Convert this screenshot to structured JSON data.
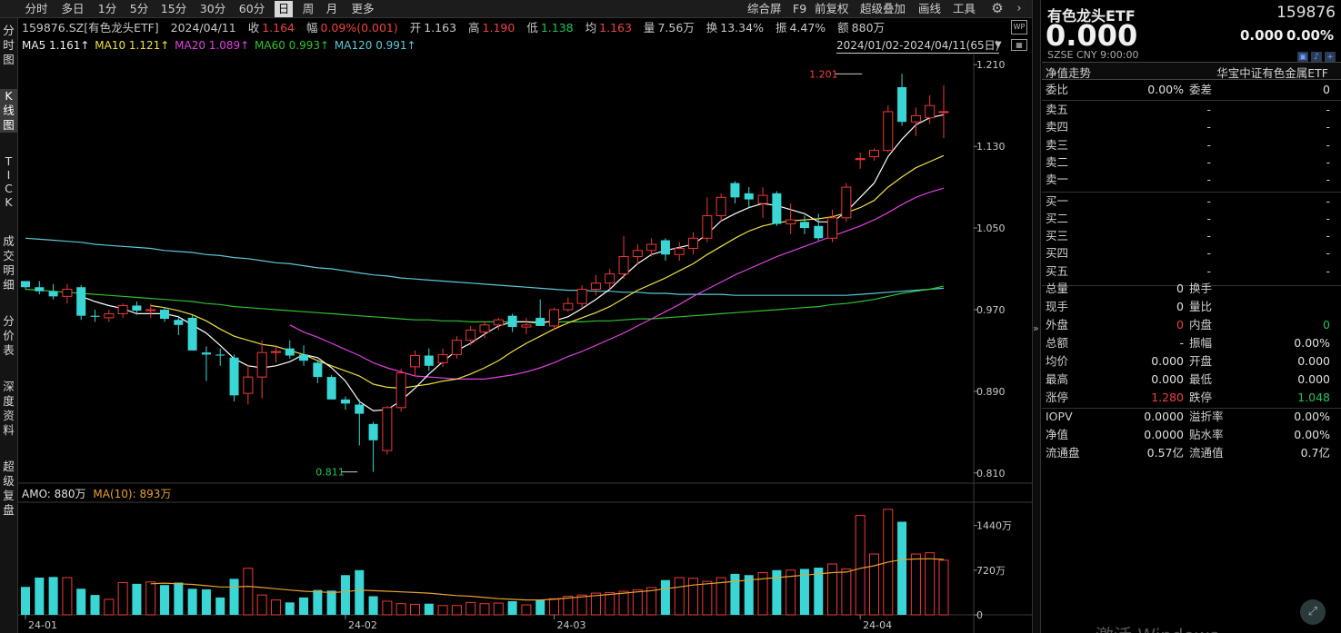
{
  "toolbar": {
    "periods": [
      "分时",
      "多日",
      "1分",
      "5分",
      "15分",
      "30分",
      "60分",
      "日",
      "周",
      "月",
      "更多"
    ],
    "active_period": "日",
    "tools": [
      "综合屏",
      "F9",
      "前复权",
      "超级叠加",
      "画线",
      "工具"
    ]
  },
  "left_tabs": [
    {
      "label": "分时图",
      "active": false
    },
    {
      "label": "K线图",
      "active": true
    },
    {
      "label": "TICK",
      "active": false
    },
    {
      "label": "成交明细",
      "active": false
    },
    {
      "label": "分价表",
      "active": false
    },
    {
      "label": "深度资料",
      "active": false
    },
    {
      "label": "超级复盘",
      "active": false
    }
  ],
  "info": {
    "symbol": "159876.SZ[有色龙头ETF]",
    "date": "2024/04/11",
    "close_label": "收",
    "close": "1.164",
    "change_label": "幅",
    "change": "0.09%(0.001)",
    "open_label": "开",
    "open": "1.163",
    "high_label": "高",
    "high": "1.190",
    "low_label": "低",
    "low": "1.138",
    "avg_label": "均",
    "avg": "1.163",
    "vol_label": "量",
    "vol": "7.56万",
    "turnover_label": "换",
    "turnover": "13.34%",
    "amplitude_label": "振",
    "amplitude": "4.47%",
    "amount_label": "额",
    "amount": "880万"
  },
  "ma_line": {
    "ma5": "MA5 1.161↑",
    "ma10": "MA10 1.121↑",
    "ma20": "MA20 1.089↑",
    "ma60": "MA60 0.993↑",
    "ma120": "MA120 0.991↑"
  },
  "date_range": "2024/01/02-2024/04/11(65日)",
  "colors": {
    "up": "#f03838",
    "down": "#3ad6d6",
    "ma5": "#ffffff",
    "ma10": "#f0e040",
    "ma20": "#e040e0",
    "ma60": "#30c030",
    "ma120": "#5cc8d8",
    "vol_ma": "#e8a030"
  },
  "amo_line": {
    "amo": "AMO: 880万",
    "ma10": "MA(10): 893万"
  },
  "chart_data": {
    "type": "candlestick",
    "y_ticks": [
      "1.210",
      "1.130",
      "1.050",
      "0.970",
      "0.890",
      "0.810"
    ],
    "ylim": [
      0.8,
      1.22
    ],
    "x_ticks": [
      {
        "label": "24-01",
        "index": 0
      },
      {
        "label": "24-02",
        "index": 23
      },
      {
        "label": "24-03",
        "index": 38
      },
      {
        "label": "24-04",
        "index": 60
      }
    ],
    "high_annotation": {
      "label": "1.201",
      "index": 60,
      "value": 1.201
    },
    "low_annotation": {
      "label": "0.811",
      "index": 24,
      "value": 0.811
    },
    "ohlc": [
      [
        0.998,
        0.998,
        0.99,
        0.992
      ],
      [
        0.992,
        0.998,
        0.985,
        0.988
      ],
      [
        0.988,
        0.995,
        0.98,
        0.983
      ],
      [
        0.983,
        0.995,
        0.976,
        0.99
      ],
      [
        0.992,
        0.994,
        0.96,
        0.964
      ],
      [
        0.964,
        0.97,
        0.958,
        0.963
      ],
      [
        0.962,
        0.97,
        0.958,
        0.966
      ],
      [
        0.966,
        0.976,
        0.962,
        0.974
      ],
      [
        0.974,
        0.978,
        0.965,
        0.969
      ],
      [
        0.969,
        0.976,
        0.962,
        0.97
      ],
      [
        0.97,
        0.972,
        0.958,
        0.961
      ],
      [
        0.96,
        0.964,
        0.945,
        0.955
      ],
      [
        0.962,
        0.965,
        0.93,
        0.93
      ],
      [
        0.928,
        0.934,
        0.9,
        0.926
      ],
      [
        0.926,
        0.932,
        0.915,
        0.925
      ],
      [
        0.923,
        0.926,
        0.88,
        0.886
      ],
      [
        0.888,
        0.916,
        0.877,
        0.904
      ],
      [
        0.904,
        0.94,
        0.883,
        0.928
      ],
      [
        0.928,
        0.935,
        0.918,
        0.929
      ],
      [
        0.932,
        0.94,
        0.922,
        0.925
      ],
      [
        0.926,
        0.935,
        0.915,
        0.92
      ],
      [
        0.918,
        0.92,
        0.898,
        0.904
      ],
      [
        0.904,
        0.906,
        0.883,
        0.882
      ],
      [
        0.882,
        0.885,
        0.872,
        0.878
      ],
      [
        0.877,
        0.882,
        0.837,
        0.868
      ],
      [
        0.858,
        0.86,
        0.811,
        0.842
      ],
      [
        0.832,
        0.876,
        0.828,
        0.874
      ],
      [
        0.874,
        0.912,
        0.87,
        0.908
      ],
      [
        0.914,
        0.93,
        0.905,
        0.925
      ],
      [
        0.925,
        0.932,
        0.91,
        0.915
      ],
      [
        0.918,
        0.932,
        0.914,
        0.926
      ],
      [
        0.926,
        0.944,
        0.922,
        0.94
      ],
      [
        0.94,
        0.954,
        0.935,
        0.95
      ],
      [
        0.948,
        0.958,
        0.942,
        0.955
      ],
      [
        0.955,
        0.962,
        0.95,
        0.96
      ],
      [
        0.964,
        0.966,
        0.948,
        0.953
      ],
      [
        0.953,
        0.962,
        0.946,
        0.955
      ],
      [
        0.962,
        0.98,
        0.955,
        0.954
      ],
      [
        0.954,
        0.972,
        0.95,
        0.97
      ],
      [
        0.97,
        0.982,
        0.968,
        0.976
      ],
      [
        0.976,
        0.994,
        0.972,
        0.99
      ],
      [
        0.99,
        1.004,
        0.984,
        0.996
      ],
      [
        0.996,
        1.01,
        0.99,
        1.005
      ],
      [
        1.005,
        1.042,
        1.0,
        1.022
      ],
      [
        1.022,
        1.034,
        1.014,
        1.028
      ],
      [
        1.028,
        1.04,
        1.022,
        1.034
      ],
      [
        1.038,
        1.04,
        1.018,
        1.024
      ],
      [
        1.024,
        1.036,
        1.018,
        1.03
      ],
      [
        1.03,
        1.046,
        1.024,
        1.04
      ],
      [
        1.04,
        1.08,
        1.036,
        1.062
      ],
      [
        1.062,
        1.084,
        1.056,
        1.08
      ],
      [
        1.094,
        1.096,
        1.074,
        1.08
      ],
      [
        1.084,
        1.09,
        1.07,
        1.078
      ],
      [
        1.074,
        1.09,
        1.06,
        1.082
      ],
      [
        1.084,
        1.086,
        1.052,
        1.054
      ],
      [
        1.054,
        1.074,
        1.044,
        1.058
      ],
      [
        1.056,
        1.062,
        1.044,
        1.05
      ],
      [
        1.052,
        1.064,
        1.038,
        1.04
      ],
      [
        1.04,
        1.068,
        1.036,
        1.06
      ],
      [
        1.06,
        1.094,
        1.056,
        1.09
      ],
      [
        1.117,
        1.124,
        1.108,
        1.118
      ],
      [
        1.12,
        1.128,
        1.116,
        1.126
      ],
      [
        1.126,
        1.17,
        1.124,
        1.164
      ],
      [
        1.188,
        1.201,
        1.15,
        1.154
      ],
      [
        1.154,
        1.168,
        1.14,
        1.16
      ],
      [
        1.158,
        1.18,
        1.152,
        1.17
      ],
      [
        1.164,
        1.19,
        1.138,
        1.164
      ]
    ],
    "ma5": [
      null,
      null,
      null,
      null,
      0.983,
      0.978,
      0.974,
      0.971,
      0.966,
      0.966,
      0.966,
      0.963,
      0.955,
      0.947,
      0.935,
      0.922,
      0.915,
      0.913,
      0.915,
      0.919,
      0.926,
      0.923,
      0.913,
      0.9,
      0.88,
      0.871,
      0.872,
      0.881,
      0.893,
      0.907,
      0.919,
      0.93,
      0.937,
      0.946,
      0.954,
      0.958,
      0.958,
      0.957,
      0.959,
      0.963,
      0.971,
      0.98,
      0.99,
      1.003,
      1.015,
      1.024,
      1.028,
      1.031,
      1.034,
      1.044,
      1.057,
      1.064,
      1.07,
      1.074,
      1.072,
      1.068,
      1.064,
      1.056,
      1.056,
      1.066,
      1.08,
      1.094,
      1.12,
      1.137,
      1.151,
      1.158,
      1.161
    ],
    "ma10": [
      null,
      null,
      null,
      null,
      null,
      null,
      null,
      null,
      null,
      0.974,
      0.972,
      0.969,
      0.965,
      0.959,
      0.951,
      0.944,
      0.94,
      0.936,
      0.934,
      0.93,
      0.926,
      0.92,
      0.915,
      0.91,
      0.905,
      0.897,
      0.894,
      0.893,
      0.895,
      0.897,
      0.9,
      0.902,
      0.907,
      0.913,
      0.92,
      0.929,
      0.937,
      0.944,
      0.951,
      0.957,
      0.962,
      0.967,
      0.973,
      0.981,
      0.989,
      0.995,
      1.001,
      1.008,
      1.015,
      1.024,
      1.032,
      1.04,
      1.047,
      1.052,
      1.055,
      1.057,
      1.058,
      1.059,
      1.061,
      1.065,
      1.07,
      1.077,
      1.09,
      1.1,
      1.109,
      1.115,
      1.121
    ],
    "ma20": [
      null,
      null,
      null,
      null,
      null,
      null,
      null,
      null,
      null,
      null,
      null,
      null,
      null,
      null,
      null,
      null,
      null,
      null,
      null,
      0.955,
      0.948,
      0.943,
      0.937,
      0.931,
      0.925,
      0.918,
      0.913,
      0.909,
      0.905,
      0.904,
      0.903,
      0.902,
      0.902,
      0.902,
      0.904,
      0.906,
      0.909,
      0.913,
      0.918,
      0.924,
      0.929,
      0.935,
      0.941,
      0.947,
      0.954,
      0.961,
      0.968,
      0.975,
      0.983,
      0.99,
      0.997,
      1.004,
      1.01,
      1.016,
      1.022,
      1.027,
      1.032,
      1.037,
      1.042,
      1.047,
      1.052,
      1.058,
      1.065,
      1.073,
      1.08,
      1.085,
      1.089
    ],
    "ma60": [
      0.99,
      0.989,
      0.988,
      0.987,
      0.986,
      0.985,
      0.984,
      0.983,
      0.982,
      0.981,
      0.98,
      0.979,
      0.978,
      0.976,
      0.975,
      0.973,
      0.972,
      0.971,
      0.97,
      0.969,
      0.968,
      0.967,
      0.966,
      0.965,
      0.964,
      0.963,
      0.962,
      0.961,
      0.96,
      0.96,
      0.959,
      0.959,
      0.958,
      0.958,
      0.958,
      0.958,
      0.958,
      0.958,
      0.958,
      0.958,
      0.958,
      0.959,
      0.959,
      0.96,
      0.961,
      0.961,
      0.962,
      0.963,
      0.964,
      0.965,
      0.966,
      0.967,
      0.968,
      0.969,
      0.97,
      0.971,
      0.972,
      0.973,
      0.975,
      0.976,
      0.978,
      0.98,
      0.983,
      0.986,
      0.988,
      0.99,
      0.993
    ],
    "ma120": [
      1.04,
      1.039,
      1.038,
      1.037,
      1.036,
      1.034,
      1.033,
      1.032,
      1.031,
      1.03,
      1.028,
      1.027,
      1.026,
      1.024,
      1.023,
      1.021,
      1.02,
      1.018,
      1.016,
      1.015,
      1.013,
      1.011,
      1.01,
      1.008,
      1.006,
      1.004,
      1.003,
      1.001,
      1.0,
      0.999,
      0.998,
      0.997,
      0.996,
      0.995,
      0.994,
      0.993,
      0.992,
      0.991,
      0.99,
      0.989,
      0.989,
      0.988,
      0.988,
      0.987,
      0.987,
      0.986,
      0.986,
      0.985,
      0.985,
      0.985,
      0.985,
      0.984,
      0.984,
      0.984,
      0.984,
      0.984,
      0.984,
      0.984,
      0.984,
      0.984,
      0.985,
      0.986,
      0.987,
      0.988,
      0.989,
      0.99,
      0.991
    ],
    "volume_ticks": [
      "1440万",
      "720万",
      "0"
    ],
    "volume_max": 1800,
    "volume": [
      450,
      600,
      610,
      600,
      420,
      320,
      250,
      520,
      500,
      530,
      480,
      520,
      420,
      410,
      280,
      580,
      750,
      320,
      240,
      200,
      280,
      400,
      390,
      640,
      720,
      300,
      220,
      180,
      170,
      180,
      150,
      150,
      200,
      180,
      190,
      220,
      160,
      240,
      260,
      300,
      320,
      350,
      360,
      380,
      400,
      440,
      560,
      600,
      590,
      540,
      600,
      660,
      640,
      680,
      720,
      720,
      740,
      760,
      820,
      740,
      1600,
      980,
      1700,
      1500,
      980,
      1000,
      880
    ],
    "volume_ma": [
      null,
      null,
      null,
      null,
      null,
      null,
      null,
      null,
      null,
      500,
      510,
      500,
      490,
      470,
      450,
      450,
      460,
      440,
      420,
      400,
      380,
      370,
      360,
      370,
      400,
      390,
      380,
      370,
      360,
      350,
      330,
      310,
      300,
      280,
      260,
      250,
      240,
      240,
      250,
      270,
      290,
      310,
      330,
      350,
      370,
      390,
      420,
      450,
      480,
      500,
      520,
      540,
      560,
      580,
      600,
      620,
      640,
      660,
      680,
      690,
      750,
      790,
      850,
      890,
      900,
      905,
      893
    ]
  },
  "panel": {
    "name": "有色龙头ETF",
    "code": "159876",
    "price": "0.000",
    "change": "0.000",
    "pct": "0.00%",
    "exchange": "SZSE   CNY   9:00:00",
    "nav_label": "净值走势",
    "index_name": "华宝中证有色金属ETF",
    "ratio": {
      "a": "委比",
      "b": "0.00%",
      "c": "委差",
      "d": "0"
    },
    "asks": [
      {
        "label": "卖五",
        "price": "-",
        "vol": "-"
      },
      {
        "label": "卖四",
        "price": "-",
        "vol": "-"
      },
      {
        "label": "卖三",
        "price": "-",
        "vol": "-"
      },
      {
        "label": "卖二",
        "price": "-",
        "vol": "-"
      },
      {
        "label": "卖一",
        "price": "-",
        "vol": "-"
      }
    ],
    "bids": [
      {
        "label": "买一",
        "price": "-",
        "vol": "-"
      },
      {
        "label": "买二",
        "price": "-",
        "vol": "-"
      },
      {
        "label": "买三",
        "price": "-",
        "vol": "-"
      },
      {
        "label": "买四",
        "price": "-",
        "vol": "-"
      },
      {
        "label": "买五",
        "price": "-",
        "vol": "-"
      }
    ],
    "stats": [
      {
        "a": "总量",
        "b": "0",
        "c": "换手",
        "d": ""
      },
      {
        "a": "现手",
        "b": "0",
        "c": "量比",
        "d": ""
      },
      {
        "a": "外盘",
        "b": "0",
        "c": "内盘",
        "d": "0"
      },
      {
        "a": "总额",
        "b": "-",
        "c": "振幅",
        "d": "0.00%"
      },
      {
        "a": "均价",
        "b": "0.000",
        "c": "开盘",
        "d": "0.000"
      },
      {
        "a": "最高",
        "b": "0.000",
        "c": "最低",
        "d": "0.000"
      },
      {
        "a": "涨停",
        "b": "1.280",
        "c": "跌停",
        "d": "1.048"
      }
    ],
    "fund": [
      {
        "a": "IOPV",
        "b": "0.0000",
        "c": "溢折率",
        "d": "0.00%"
      },
      {
        "a": "净值",
        "b": "0.0000",
        "c": "贴水率",
        "d": "0.00%"
      },
      {
        "a": "流通盘",
        "b": "0.57亿",
        "c": "流通值",
        "d": "0.7亿"
      }
    ]
  },
  "watermark": "激活 Windows"
}
